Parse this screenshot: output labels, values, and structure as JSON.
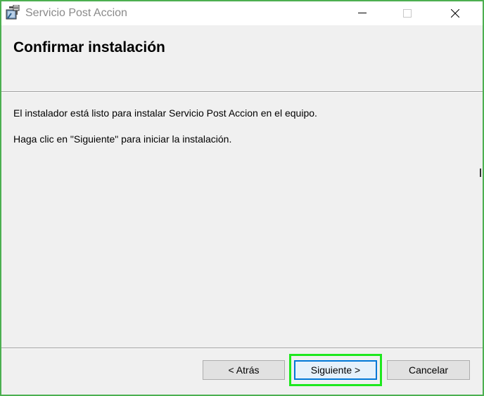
{
  "window": {
    "title": "Servicio Post Accion",
    "icon": "installer-package-icon"
  },
  "title_controls": {
    "minimize_icon": "minimize-icon",
    "maximize_icon": "maximize-icon",
    "close_icon": "close-icon"
  },
  "header": {
    "title": "Confirmar instalación"
  },
  "content": {
    "line1": "El instalador está listo para instalar Servicio Post Accion en el equipo.",
    "line2": "Haga clic en \"Siguiente\" para iniciar la instalación."
  },
  "buttons": {
    "back_label": "< Atrás",
    "next_label": "Siguiente >",
    "cancel_label": "Cancelar"
  },
  "colors": {
    "window_border": "#4caf50",
    "highlight": "#1ee81e",
    "focus_border": "#0078d7"
  }
}
